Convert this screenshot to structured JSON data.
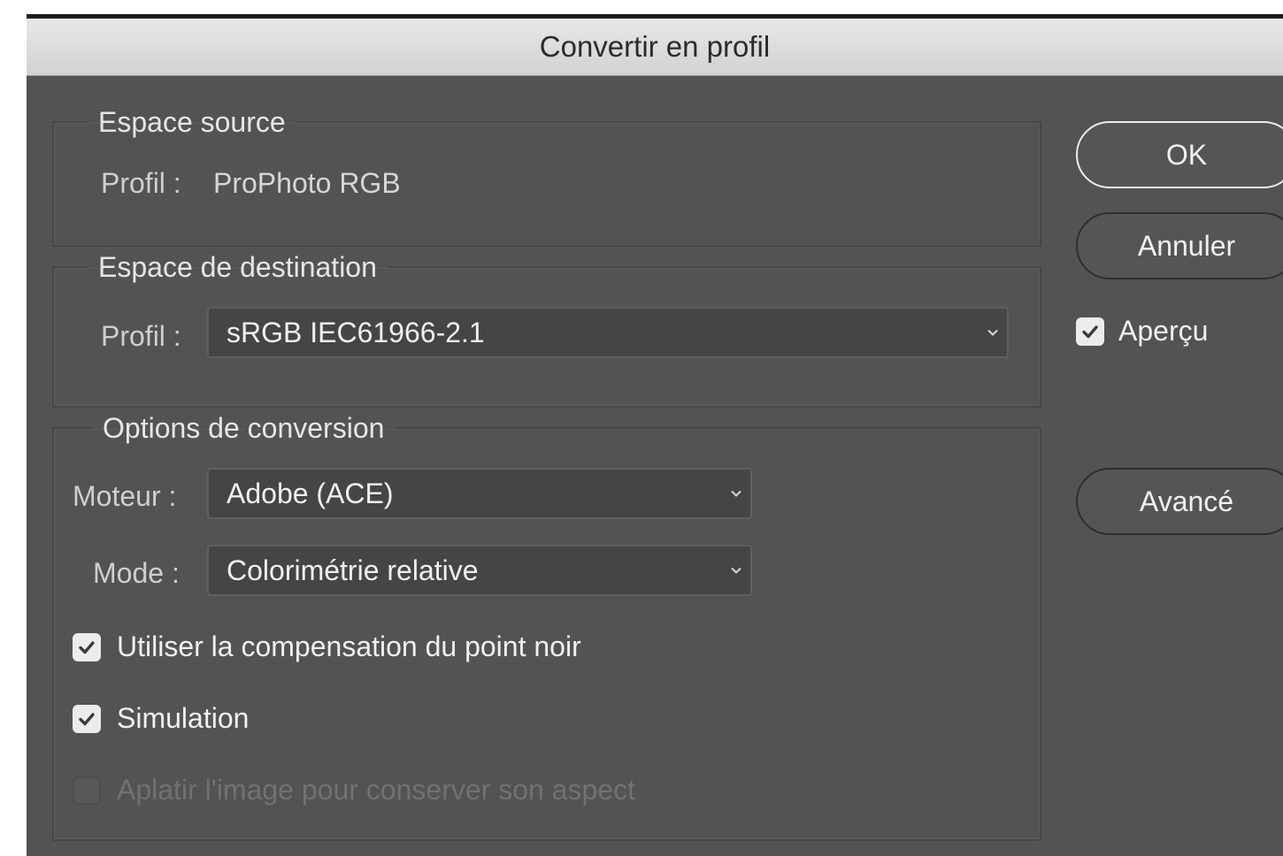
{
  "dialog": {
    "title": "Convertir en profil"
  },
  "source": {
    "legend": "Espace source",
    "profile_label": "Profil :",
    "profile_value": "ProPhoto RGB"
  },
  "destination": {
    "legend": "Espace de destination",
    "profile_label": "Profil :",
    "profile_selected": "sRGB IEC61966-2.1"
  },
  "conversion": {
    "legend": "Options de conversion",
    "engine_label": "Moteur :",
    "engine_selected": "Adobe (ACE)",
    "mode_label": "Mode :",
    "mode_selected": "Colorimétrie relative",
    "checkboxes": [
      {
        "label": "Utiliser la compensation du point noir",
        "checked": true,
        "enabled": true
      },
      {
        "label": "Simulation",
        "checked": true,
        "enabled": true
      },
      {
        "label": "Aplatir l'image pour conserver son aspect",
        "checked": false,
        "enabled": false
      }
    ]
  },
  "buttons": {
    "ok": "OK",
    "cancel": "Annuler",
    "advanced": "Avancé"
  },
  "preview": {
    "label": "Aperçu",
    "checked": true
  },
  "icons": {
    "dropdown": "chevron-down-icon",
    "check": "checkmark-icon"
  },
  "colors": {
    "dialog_bg": "#535353",
    "titlebar": "#dcdcdc",
    "text": "#f0f0f0",
    "disabled_text": "#717171"
  }
}
